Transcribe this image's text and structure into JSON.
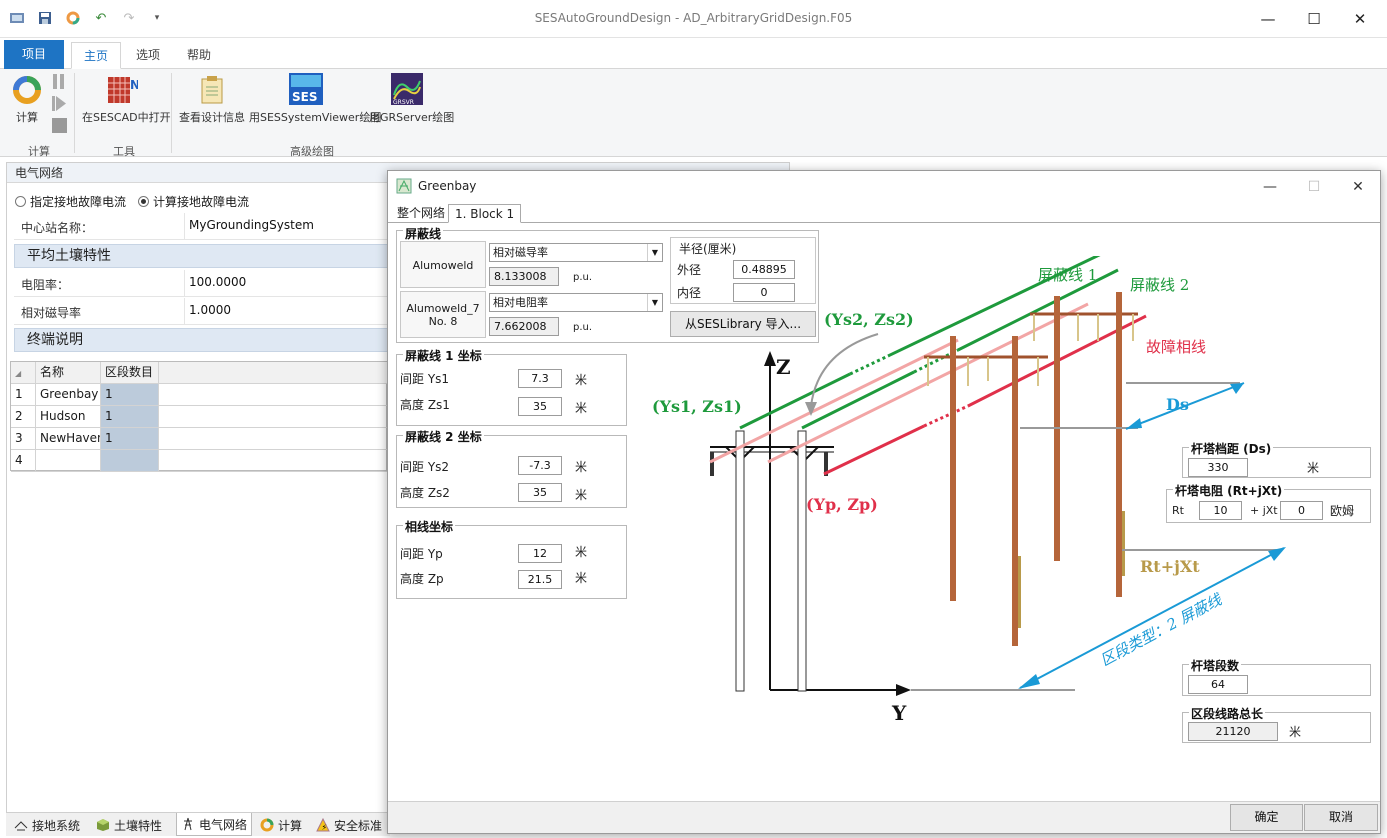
{
  "app": {
    "title": "SESAutoGroundDesign - AD_ArbitraryGridDesign.F05",
    "quick_access": [
      "app-icon",
      "save-icon",
      "refresh-icon",
      "undo-icon",
      "redo-icon",
      "customize-icon"
    ],
    "win_min": "—",
    "win_max": "☐",
    "win_close": "✕"
  },
  "ribbon": {
    "tabs": [
      "项目",
      "主页",
      "选项",
      "帮助"
    ],
    "active_tab": "主页",
    "compute_label": "计算",
    "compute_group": "计算",
    "sescad_label": "在SESCAD中打开",
    "tools_group": "工具",
    "design_info_label": "查看设计信息",
    "sesviewer_label": "用SESSystemViewer绘图",
    "grserver_label": "用GRServer绘图",
    "advanced_group": "高级绘图"
  },
  "left": {
    "panel_title": "电气网络",
    "radio_specify": "指定接地故障电流",
    "radio_compute": "计算接地故障电流",
    "station_label": "中心站名称：",
    "station_value": "MyGroundingSystem",
    "soil_section": "平均土壤特性",
    "resistivity_label": "电阻率：",
    "resistivity_value": "100.0000",
    "permeability_label": "相对磁导率",
    "permeability_value": "1.0000",
    "terminal_section": "终端说明",
    "grid_headers": [
      "名称",
      "区段数目"
    ],
    "grid_rows": [
      {
        "n": "1",
        "name": "Greenbay",
        "seg": "1"
      },
      {
        "n": "2",
        "name": "Hudson",
        "seg": "1"
      },
      {
        "n": "3",
        "name": "NewHaven",
        "seg": "1"
      },
      {
        "n": "4",
        "name": "",
        "seg": ""
      }
    ]
  },
  "bottom_tabs": [
    "接地系统",
    "土壤特性",
    "电气网络",
    "计算",
    "安全标准"
  ],
  "dialog": {
    "title": "Greenbay",
    "tabs": [
      "整个网络",
      "1. Block 1"
    ],
    "shield_group": "屏蔽线",
    "cond1_name": "Alumoweld",
    "cond1_prop": "相对磁导率",
    "cond1_value": "8.133008",
    "cond2_name": "Alumoweld_7 No. 8",
    "cond2_prop": "相对电阻率",
    "cond2_value": "7.662008",
    "pu": "p.u.",
    "radius_group": "半径(厘米)",
    "outer_label": "外径",
    "outer_value": "0.48895",
    "inner_label": "内径",
    "inner_value": "0",
    "import_btn": "从SESLibrary 导入...",
    "sw1_group": "屏蔽线 1 坐标",
    "sw1_y_label": "间距 Ys1",
    "sw1_y": "7.3",
    "sw1_z_label": "高度 Zs1",
    "sw1_z": "35",
    "sw2_group": "屏蔽线 2 坐标",
    "sw2_y_label": "间距 Ys2",
    "sw2_y": "-7.3",
    "sw2_z_label": "高度 Zs2",
    "sw2_z": "35",
    "phase_group": "相线坐标",
    "ph_y_label": "间距 Yp",
    "ph_y": "12",
    "ph_z_label": "高度 Zp",
    "ph_z": "21.5",
    "unit_m": "米",
    "span_group": "杆塔档距 (Ds)",
    "span_value": "330",
    "res_group": "杆塔电阻 (Rt+jXt)",
    "rt_label": "Rt",
    "rt_value": "10",
    "xt_label": "+ jXt",
    "xt_value": "0",
    "ohm": "欧姆",
    "count_group": "杆塔段数",
    "count_value": "64",
    "length_group": "区段线路总长",
    "length_value": "21120",
    "ok": "确定",
    "cancel": "取消",
    "diagram": {
      "sw1": "屏蔽线 1",
      "sw2": "屏蔽线 2",
      "fault": "故障相线",
      "ys2zs2": "(Ys2, Zs2)",
      "ys1zs1": "(Ys1, Zs1)",
      "ypzp": "(Yp, Zp)",
      "z": "Z",
      "y": "Y",
      "ds": "Ds",
      "rtjxt": "Rt+jXt",
      "section_type": "区段类型：2 屏蔽线"
    }
  },
  "colors": {
    "accent": "#1e74c4",
    "green": "#1e9a3c",
    "red": "#e0304a",
    "pink": "#f2a5a5",
    "blue": "#1a9ad6",
    "brown": "#a0522d",
    "tan": "#b89a4a"
  }
}
